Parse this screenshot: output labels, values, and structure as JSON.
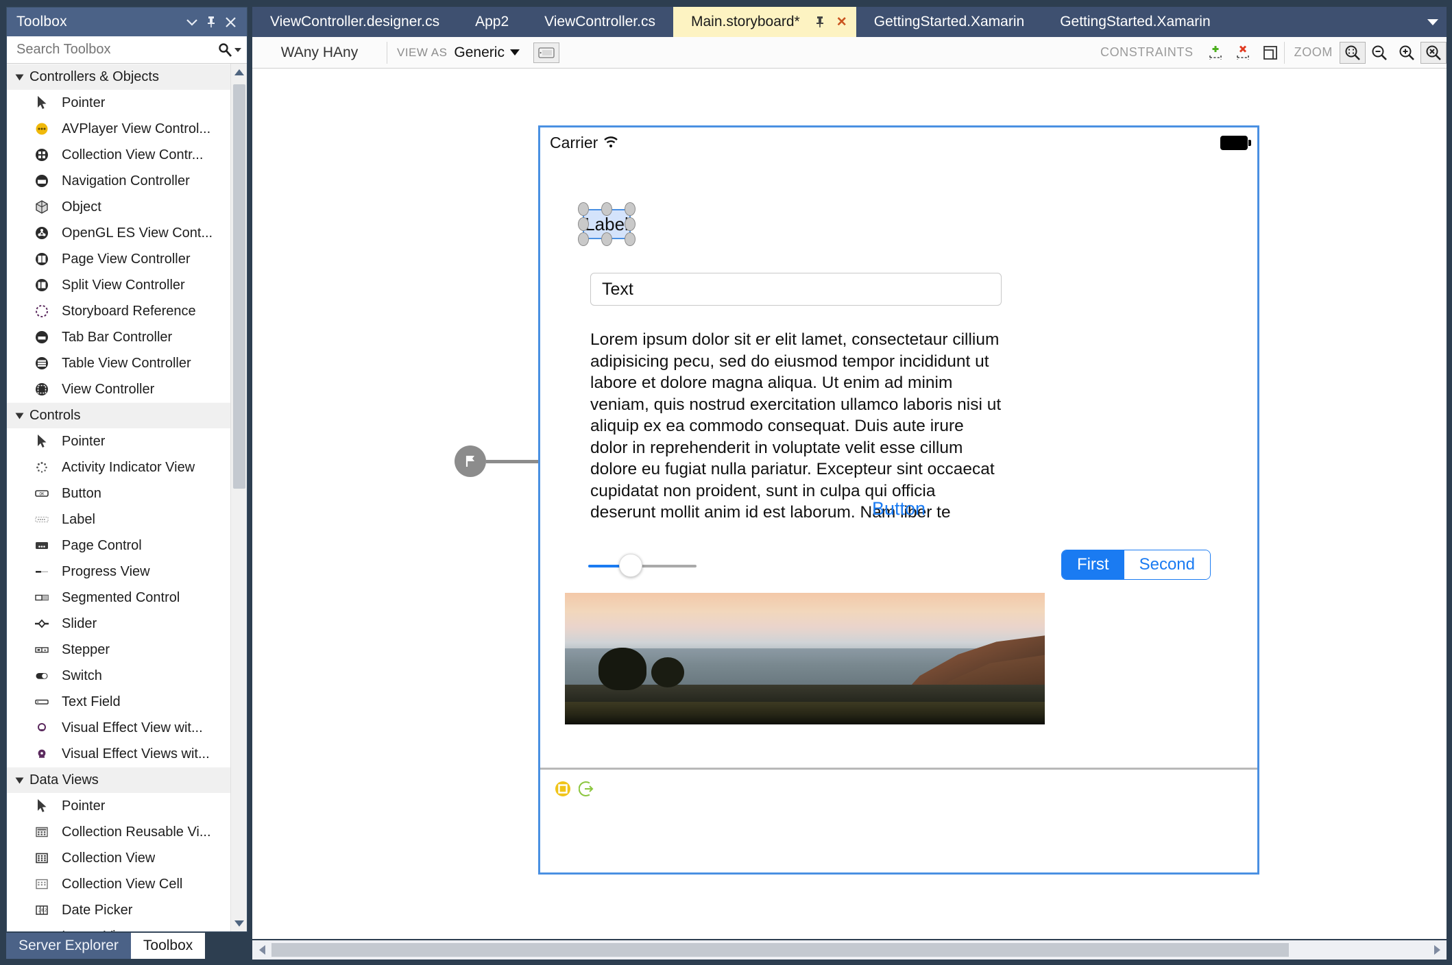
{
  "toolbox": {
    "title": "Toolbox",
    "search_placeholder": "Search Toolbox",
    "groups": [
      {
        "name": "Controllers & Objects",
        "items": [
          {
            "label": "Pointer",
            "icon": "pointer-icon"
          },
          {
            "label": "AVPlayer View Control...",
            "icon": "avplayer-view-controller-icon"
          },
          {
            "label": "Collection View Contr...",
            "icon": "collection-view-controller-icon"
          },
          {
            "label": "Navigation Controller",
            "icon": "navigation-controller-icon"
          },
          {
            "label": "Object",
            "icon": "object-icon"
          },
          {
            "label": "OpenGL ES View Cont...",
            "icon": "opengl-es-view-controller-icon"
          },
          {
            "label": "Page View Controller",
            "icon": "page-view-controller-icon"
          },
          {
            "label": "Split View Controller",
            "icon": "split-view-controller-icon"
          },
          {
            "label": "Storyboard Reference",
            "icon": "storyboard-reference-icon"
          },
          {
            "label": "Tab Bar Controller",
            "icon": "tab-bar-controller-icon"
          },
          {
            "label": "Table View Controller",
            "icon": "table-view-controller-icon"
          },
          {
            "label": "View Controller",
            "icon": "view-controller-icon"
          }
        ]
      },
      {
        "name": "Controls",
        "items": [
          {
            "label": "Pointer",
            "icon": "pointer-icon"
          },
          {
            "label": "Activity Indicator View",
            "icon": "activity-indicator-icon"
          },
          {
            "label": "Button",
            "icon": "button-icon"
          },
          {
            "label": "Label",
            "icon": "label-icon"
          },
          {
            "label": "Page Control",
            "icon": "page-control-icon"
          },
          {
            "label": "Progress View",
            "icon": "progress-view-icon"
          },
          {
            "label": "Segmented Control",
            "icon": "segmented-control-icon"
          },
          {
            "label": "Slider",
            "icon": "slider-icon"
          },
          {
            "label": "Stepper",
            "icon": "stepper-icon"
          },
          {
            "label": "Switch",
            "icon": "switch-icon"
          },
          {
            "label": "Text Field",
            "icon": "text-field-icon"
          },
          {
            "label": "Visual Effect View wit...",
            "icon": "visual-effect-view-icon"
          },
          {
            "label": "Visual Effect Views wit...",
            "icon": "visual-effect-views-icon"
          }
        ]
      },
      {
        "name": "Data Views",
        "items": [
          {
            "label": "Pointer",
            "icon": "pointer-icon"
          },
          {
            "label": "Collection Reusable Vi...",
            "icon": "collection-reusable-view-icon"
          },
          {
            "label": "Collection View",
            "icon": "collection-view-icon"
          },
          {
            "label": "Collection View Cell",
            "icon": "collection-view-cell-icon"
          },
          {
            "label": "Date Picker",
            "icon": "date-picker-icon"
          },
          {
            "label": "Image View",
            "icon": "image-view-icon"
          }
        ]
      }
    ],
    "bottom_tabs": [
      {
        "label": "Server Explorer",
        "active": false
      },
      {
        "label": "Toolbox",
        "active": true
      }
    ]
  },
  "document_tabs": [
    {
      "label": "ViewController.designer.cs",
      "active": false,
      "dirty": false
    },
    {
      "label": "App2",
      "active": false,
      "dirty": false
    },
    {
      "label": "ViewController.cs",
      "active": false,
      "dirty": false
    },
    {
      "label": "Main.storyboard*",
      "active": true,
      "dirty": true
    },
    {
      "label": "GettingStarted.Xamarin",
      "active": false,
      "dirty": false
    },
    {
      "label": "GettingStarted.Xamarin",
      "active": false,
      "dirty": false
    }
  ],
  "designer_toolbar": {
    "size_class": "WAny HAny",
    "view_as_label": "VIEW AS",
    "view_as_value": "Generic",
    "constraints_label": "CONSTRAINTS",
    "zoom_label": "ZOOM"
  },
  "device": {
    "status_bar": {
      "carrier": "Carrier",
      "wifi_icon": "wifi-icon",
      "battery_icon": "battery-icon"
    },
    "label": {
      "text": "Label",
      "selected": true
    },
    "text_field": {
      "value": "Text"
    },
    "body_text": "Lorem ipsum dolor sit er elit lamet, consectetaur cillium adipisicing pecu, sed do eiusmod tempor incididunt ut labore et dolore magna aliqua. Ut enim ad minim veniam, quis nostrud exercitation ullamco laboris nisi ut aliquip ex ea commodo consequat. Duis aute irure dolor in reprehenderit in voluptate velit esse cillum dolore eu fugiat nulla pariatur. Excepteur sint occaecat cupidatat non proident, sunt in culpa qui officia deserunt mollit anim id est laborum. Nam liber te",
    "button": {
      "label": "Button",
      "color": "#1a7bf2"
    },
    "slider": {
      "value_percent": 48
    },
    "segmented_control": {
      "segments": [
        "First",
        "Second"
      ],
      "selected_index": 0,
      "accent": "#1a7bf2"
    },
    "image_view": {
      "description": "coastal-sunset-photo"
    },
    "bottom_bar": {
      "icons": [
        "view-controller-badge-icon",
        "exit-segue-icon"
      ]
    }
  },
  "colors": {
    "accent_blue": "#1a7bf2",
    "selection_blue": "#4a90e2",
    "tab_active_yellow": "#fdf3c2",
    "chrome_blue": "#3e5070",
    "panel_header_blue": "#4b6287"
  }
}
